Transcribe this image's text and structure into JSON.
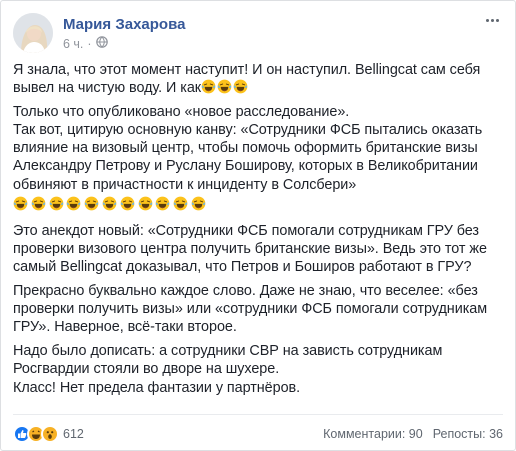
{
  "post": {
    "author": "Мария Захарова",
    "time": "6 ч.",
    "separator": "·",
    "privacy_icon": "globe-icon",
    "menu_icon": "more-options-icon"
  },
  "body": {
    "p1": "Я знала, что этот момент наступит! И он наступил. Bellingcat сам себя вывел на чистую воду. И как",
    "p2": "Только что опубликовано «новое расследование».\nТак вот, цитирую основную канву: «Сотрудники ФСБ пытались оказать влияние на визовый центр, чтобы помочь оформить британские визы Александру Петрову и Руслану Боширову, которых в Великобритании обвиняют в причастности к инциденту в Солсбери»",
    "p3": "Это анекдот новый: «Сотрудники ФСБ помогали сотрудникам ГРУ без проверки визового центра получить британские визы». Ведь это тот же самый Bellingcat доказывал, что Петров и Боширов работают в ГРУ?",
    "p4": "Прекрасно буквально каждое слово. Даже не знаю, что веселее: «без проверки получить визы» или «сотрудники ФСБ помогали сотрудникам ГРУ». Наверное, всё-таки второе.",
    "p5": "Надо было дописать: а сотрудники СВР на зависть сотрудникам Росгвардии стояли во дворе на шухере.\nКласс! Нет предела фантазии у партнёров."
  },
  "emoji": {
    "name": "laughing-tears-emoji",
    "inline_count": 3,
    "row_count": 11
  },
  "footer": {
    "reaction_icons": [
      "like-reaction-icon",
      "haha-reaction-icon",
      "wow-reaction-icon"
    ],
    "reaction_count": "612",
    "comments": "Комментарии: 90",
    "shares": "Репосты: 36"
  },
  "colors": {
    "author": "#365899",
    "text": "#1d2129",
    "meta": "#90949c",
    "like": "#1877f2",
    "haha": "#f7b125"
  }
}
